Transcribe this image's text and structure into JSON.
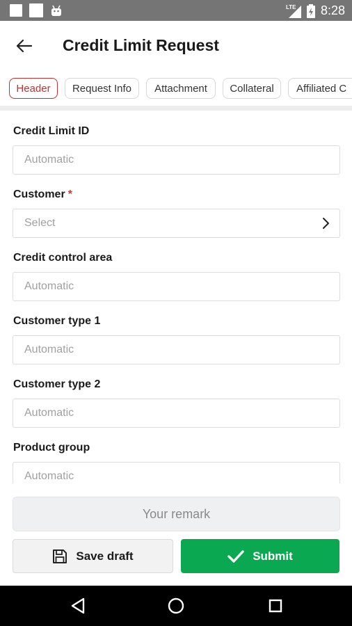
{
  "status_bar": {
    "network": "LTE",
    "time": "8:28"
  },
  "header": {
    "title": "Credit Limit Request"
  },
  "tabs": [
    {
      "label": "Header",
      "active": true
    },
    {
      "label": "Request Info",
      "active": false
    },
    {
      "label": "Attachment",
      "active": false
    },
    {
      "label": "Collateral",
      "active": false
    },
    {
      "label": "Affiliated C",
      "active": false
    }
  ],
  "form": {
    "credit_limit_id": {
      "label": "Credit Limit ID",
      "placeholder": "Automatic"
    },
    "customer": {
      "label": "Customer",
      "required_mark": "*",
      "placeholder": "Select"
    },
    "credit_control_area": {
      "label": "Credit control area",
      "placeholder": "Automatic"
    },
    "customer_type_1": {
      "label": "Customer type 1",
      "placeholder": "Automatic"
    },
    "customer_type_2": {
      "label": "Customer type 2",
      "placeholder": "Automatic"
    },
    "product_group": {
      "label": "Product group",
      "placeholder": "Automatic"
    }
  },
  "remark": {
    "placeholder": "Your remark"
  },
  "actions": {
    "save_draft_label": "Save draft",
    "submit_label": "Submit"
  },
  "colors": {
    "accent_red": "#c62f2f",
    "submit_green": "#0aa850",
    "status_bar": "#757575"
  },
  "icons": {
    "back": "arrow-left-icon",
    "chevron": "chevron-right-icon",
    "save": "floppy-disk-icon",
    "submit": "checkmark-icon",
    "nav_back": "triangle-back-icon",
    "nav_home": "circle-home-icon",
    "nav_recents": "square-recents-icon"
  }
}
